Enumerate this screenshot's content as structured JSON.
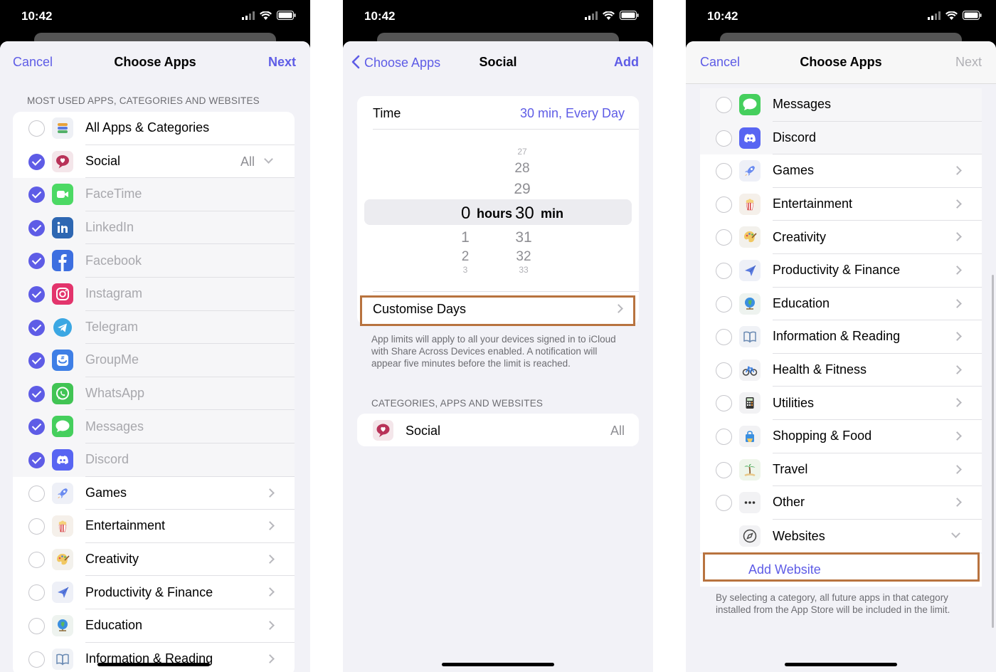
{
  "status_time": "10:42",
  "screen1": {
    "nav": {
      "left": "Cancel",
      "title": "Choose Apps",
      "right": "Next"
    },
    "section_header": "MOST USED APPS, CATEGORIES AND WEBSITES",
    "rows": [
      {
        "label": "All Apps & Categories",
        "checked": false,
        "icon": "stack-icon"
      },
      {
        "label": "Social",
        "checked": true,
        "value": "All",
        "icon": "social-heart-icon"
      },
      {
        "label": "FaceTime",
        "checked": true,
        "icon": "facetime-icon"
      },
      {
        "label": "LinkedIn",
        "checked": true,
        "icon": "linkedin-icon"
      },
      {
        "label": "Facebook",
        "checked": true,
        "icon": "facebook-icon"
      },
      {
        "label": "Instagram",
        "checked": true,
        "icon": "instagram-icon"
      },
      {
        "label": "Telegram",
        "checked": true,
        "icon": "telegram-icon"
      },
      {
        "label": "GroupMe",
        "checked": true,
        "icon": "groupme-icon"
      },
      {
        "label": "WhatsApp",
        "checked": true,
        "icon": "whatsapp-icon"
      },
      {
        "label": "Messages",
        "checked": true,
        "icon": "messages-icon"
      },
      {
        "label": "Discord",
        "checked": true,
        "icon": "discord-icon"
      },
      {
        "label": "Games",
        "checked": false,
        "icon": "rocket-icon"
      },
      {
        "label": "Entertainment",
        "checked": false,
        "icon": "popcorn-icon"
      },
      {
        "label": "Creativity",
        "checked": false,
        "icon": "palette-icon"
      },
      {
        "label": "Productivity & Finance",
        "checked": false,
        "icon": "paper-plane-icon"
      },
      {
        "label": "Education",
        "checked": false,
        "icon": "globe-icon"
      },
      {
        "label": "Information & Reading",
        "checked": false,
        "icon": "book-icon"
      }
    ]
  },
  "screen2": {
    "nav": {
      "left": "Choose Apps",
      "title": "Social",
      "right": "Add"
    },
    "time_label": "Time",
    "time_value": "30 min, Every Day",
    "picker": {
      "hours_above": [],
      "hours_selected": "0",
      "hours_unit": "hours",
      "hours_below": [
        "1",
        "2",
        "3"
      ],
      "mins_above": [
        "27",
        "28",
        "29"
      ],
      "mins_selected": "30",
      "mins_unit": "min",
      "mins_below": [
        "31",
        "32",
        "33"
      ]
    },
    "customise_days": "Customise Days",
    "footnote": "App limits will apply to all your devices signed in to iCloud with Share Across Devices enabled. A notification will appear five minutes before the limit is reached.",
    "section_header": "CATEGORIES, APPS AND WEBSITES",
    "social_label": "Social",
    "social_value": "All"
  },
  "screen3": {
    "nav": {
      "left": "Cancel",
      "title": "Choose Apps",
      "right": "Next"
    },
    "rows": [
      {
        "label": "Messages",
        "icon": "messages-icon"
      },
      {
        "label": "Discord",
        "icon": "discord-icon"
      },
      {
        "label": "Games",
        "icon": "rocket-icon"
      },
      {
        "label": "Entertainment",
        "icon": "popcorn-icon"
      },
      {
        "label": "Creativity",
        "icon": "palette-icon"
      },
      {
        "label": "Productivity & Finance",
        "icon": "paper-plane-icon"
      },
      {
        "label": "Education",
        "icon": "globe-icon"
      },
      {
        "label": "Information & Reading",
        "icon": "book-icon"
      },
      {
        "label": "Health & Fitness",
        "icon": "bicycle-icon"
      },
      {
        "label": "Utilities",
        "icon": "calculator-icon"
      },
      {
        "label": "Shopping & Food",
        "icon": "shopping-bag-icon"
      },
      {
        "label": "Travel",
        "icon": "palm-tree-icon"
      },
      {
        "label": "Other",
        "icon": "ellipsis-icon"
      },
      {
        "label": "Websites",
        "icon": "compass-icon"
      }
    ],
    "add_website": "Add Website",
    "footnote": "By selecting a category, all future apps in that category installed from the App Store will be included in the limit."
  },
  "colors": {
    "accent": "#5e5ce6",
    "highlight": "#b8733f"
  }
}
